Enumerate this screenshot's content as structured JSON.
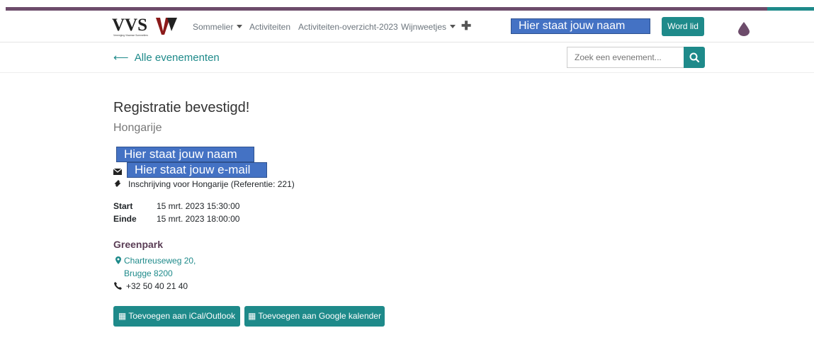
{
  "header": {
    "logo_text": "VVS",
    "logo_subtext": "Vereniging Vlaamse Sommeliers",
    "nav": [
      {
        "label": "Sommelier",
        "dropdown": true
      },
      {
        "label": "Activiteiten",
        "dropdown": false
      },
      {
        "label": "Activiteiten-overzicht-2023",
        "dropdown": false
      },
      {
        "label": "Wijnweetjes",
        "dropdown": true
      }
    ],
    "user_name_placeholder": "Hier staat jouw naam",
    "join_label": "Word lid"
  },
  "subbar": {
    "back_label": "Alle evenementen",
    "search_placeholder": "Zoek een evenement..."
  },
  "registration": {
    "title": "Registratie bevestigd!",
    "event_name": "Hongarije",
    "attendee_name": "Hier staat jouw naam",
    "attendee_email": "Hier staat jouw e-mail",
    "ticket_text": "Inschrijving voor Hongarije (Referentie: 221)",
    "start_label": "Start",
    "start_value": "15 mrt. 2023 15:30:00",
    "end_label": "Einde",
    "end_value": "15 mrt. 2023 18:00:00"
  },
  "venue": {
    "name": "Greenpark",
    "address_line1": "Chartreuseweg 20,",
    "address_line2": "Brugge 8200",
    "phone": "+32 50 40 21 40"
  },
  "actions": {
    "ical_label": "Toevoegen aan iCal/Outlook",
    "google_label": "Toevoegen aan Google kalender"
  },
  "colors": {
    "accent": "#1e8a8a",
    "brand": "#6d4c6b",
    "highlight": "#4472c4"
  }
}
